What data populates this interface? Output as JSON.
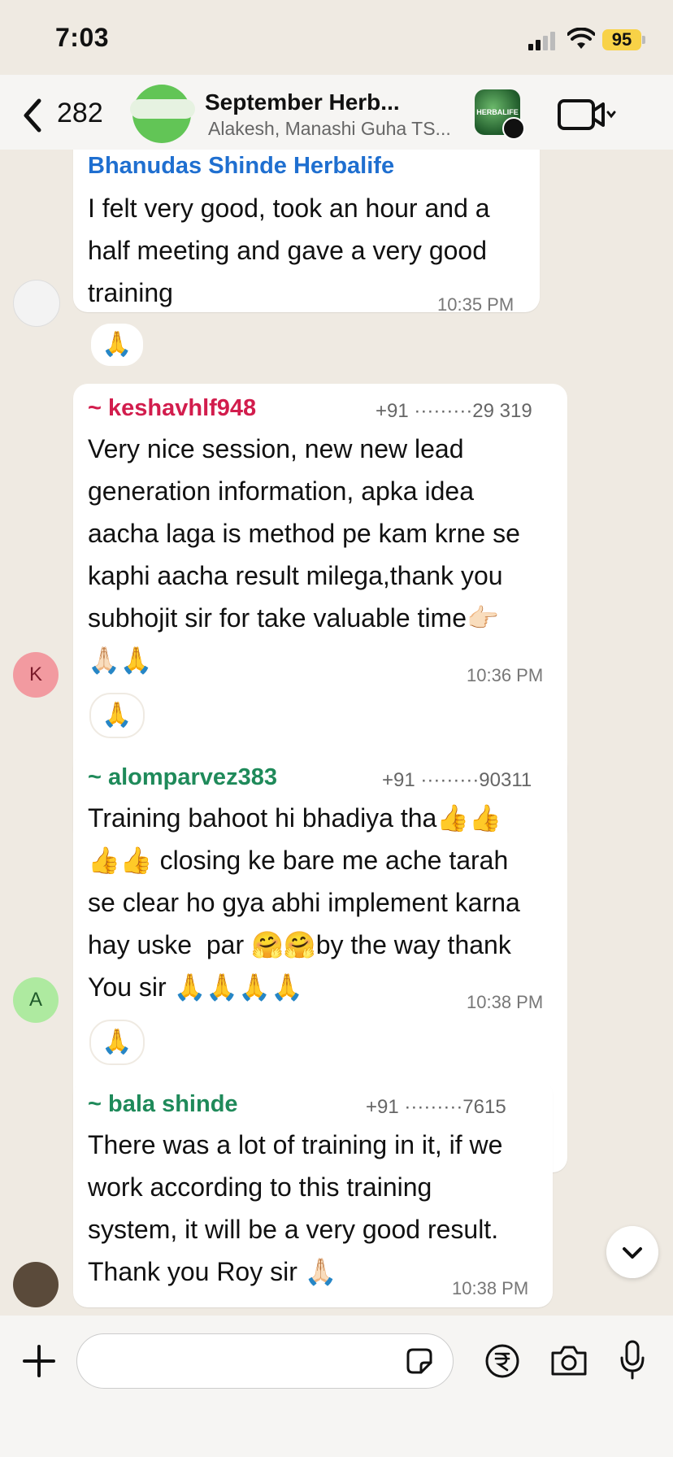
{
  "status_bar": {
    "time": "7:03",
    "battery": "95"
  },
  "header": {
    "back_count": "282",
    "title": "September Herb...",
    "subtitle": "Alakesh, Manashi Guha TS...",
    "logo_text": "HERBALIFE"
  },
  "messages": [
    {
      "sender": "Bhanudas Shinde Herbalife",
      "phone": "",
      "text": "I felt very good, took an hour and a\nhalf meeting and gave a very good\ntraining",
      "time": "10:35 PM",
      "reaction": "🙏",
      "avatar_letter": ""
    },
    {
      "sender": "~ keshavhlf948",
      "phone": "+91 ·········29 319",
      "text": "Very nice session, new new lead\ngeneration information, apka idea\naacha laga is method pe kam krne se\nkaphi aacha result milega,thank you\nsubhojit sir for take valuable time👉🏻\n🙏🏻🙏",
      "time": "10:36 PM",
      "reaction": "🙏",
      "avatar_letter": "K"
    },
    {
      "sender": "~ alomparvez383",
      "phone": "+91 ·········90311",
      "text": "Training bahoot hi bhadiya tha👍👍\n👍👍 closing ke bare me ache tarah\nse clear ho gya abhi implement karna\nhay uske  par 🤗🤗by the way thank\nYou sir 🙏🙏🙏🙏",
      "time": "10:38 PM",
      "reaction": "🙏",
      "avatar_letter": "A"
    },
    {
      "sender": "~ bala shinde",
      "phone": "+91 ·········7615",
      "text": "There was a lot of training in it, if we\nwork according to this training\nsystem, it will be a very good result.\nThank you Roy sir 🙏🏻",
      "time": "10:38 PM",
      "reaction": "",
      "avatar_letter": ""
    }
  ],
  "colors": {
    "chat_bg": "#efeae2",
    "sender_blue": "#1f6fd0",
    "sender_red": "#d21d4d",
    "sender_green": "#1f8a5a",
    "avatar_k": "#f29aa0",
    "avatar_a": "#aeeaa0"
  },
  "input": {
    "placeholder": ""
  }
}
